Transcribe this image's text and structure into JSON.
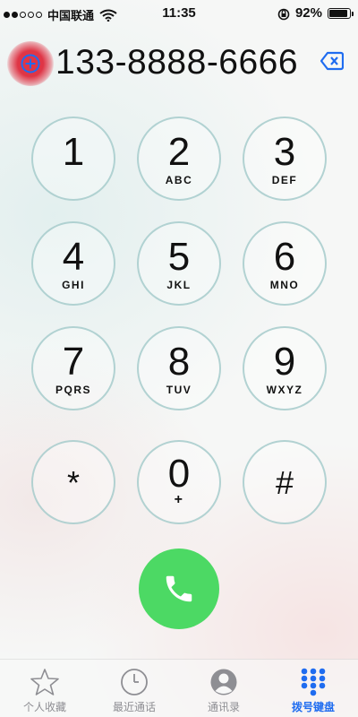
{
  "status_bar": {
    "carrier": "中国联通",
    "time": "11:35",
    "battery": "92%",
    "battery_level": 0.92
  },
  "dialer": {
    "number": "133-8888-6666",
    "add_contact_icon": "plus-circle-icon",
    "delete_icon": "backspace-icon"
  },
  "keypad": {
    "keys": [
      {
        "digit": "1",
        "letters": ""
      },
      {
        "digit": "2",
        "letters": "ABC"
      },
      {
        "digit": "3",
        "letters": "DEF"
      },
      {
        "digit": "4",
        "letters": "GHI"
      },
      {
        "digit": "5",
        "letters": "JKL"
      },
      {
        "digit": "6",
        "letters": "MNO"
      },
      {
        "digit": "7",
        "letters": "PQRS"
      },
      {
        "digit": "8",
        "letters": "TUV"
      },
      {
        "digit": "9",
        "letters": "WXYZ"
      },
      {
        "digit": "*",
        "letters": ""
      },
      {
        "digit": "0",
        "letters": "+"
      },
      {
        "digit": "#",
        "letters": ""
      }
    ],
    "call_icon": "phone-icon",
    "call_color": "#4cd964"
  },
  "tab_bar": {
    "tabs": [
      {
        "label": "个人收藏",
        "icon": "star-icon"
      },
      {
        "label": "最近通话",
        "icon": "clock-icon"
      },
      {
        "label": "通讯录",
        "icon": "contacts-icon"
      },
      {
        "label": "拨号键盘",
        "icon": "keypad-icon"
      }
    ],
    "active_tab": "拨号键盘",
    "active_color": "#1f6cf0"
  }
}
